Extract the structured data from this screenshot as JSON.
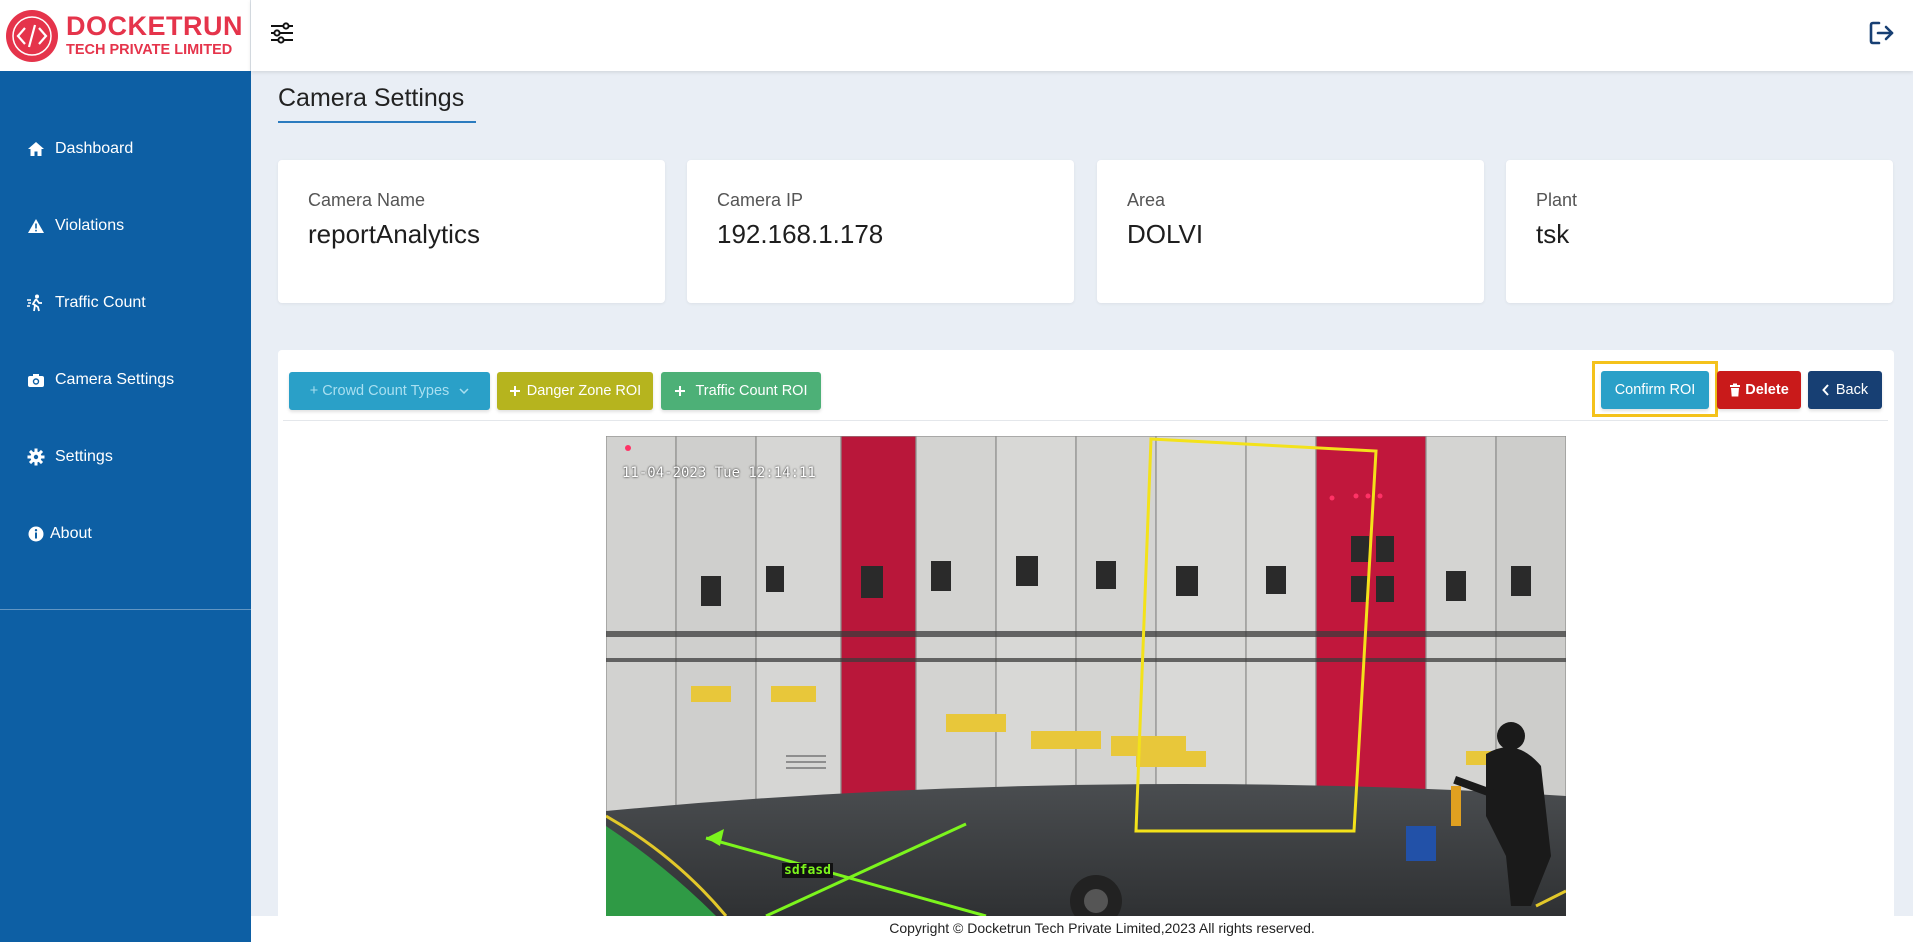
{
  "brand": {
    "name": "DOCKETRUN",
    "subtitle": "TECH PRIVATE LIMITED"
  },
  "sidebar": {
    "items": [
      {
        "label": "Dashboard",
        "icon": "home-icon"
      },
      {
        "label": "Violations",
        "icon": "warning-icon"
      },
      {
        "label": "Traffic Count",
        "icon": "walking-icon"
      },
      {
        "label": "Camera Settings",
        "icon": "camera-icon"
      },
      {
        "label": "Settings",
        "icon": "gear-icon"
      },
      {
        "label": "About",
        "icon": "info-icon"
      }
    ]
  },
  "topbar": {
    "menu_icon": "sliders-icon",
    "logout_icon": "logout-icon"
  },
  "page": {
    "title": "Camera Settings"
  },
  "cards": [
    {
      "label": "Camera Name",
      "value": "reportAnalytics"
    },
    {
      "label": "Camera IP",
      "value": "192.168.1.178"
    },
    {
      "label": "Area",
      "value": "DOLVI"
    },
    {
      "label": "Plant",
      "value": "tsk"
    }
  ],
  "toolbar": {
    "crowd_count_label": "+ Crowd Count Types",
    "danger_zone_label": "Danger Zone ROI",
    "traffic_count_label": "Traffic Count ROI",
    "confirm_label": "Confirm ROI",
    "delete_label": "Delete",
    "back_label": "Back"
  },
  "camera": {
    "timestamp": "11-04-2023 Tue 12:14:11",
    "roi_tag": "sdfasd",
    "roi_color": "#f3e21a",
    "line_color": "#7cf51d"
  },
  "colors": {
    "sidebar": "#0d5fa4",
    "brand": "#e5344b",
    "highlight": "#f4c21b"
  },
  "footer": {
    "text": "Copyright © Docketrun Tech Private Limited,2023 All rights reserved."
  }
}
